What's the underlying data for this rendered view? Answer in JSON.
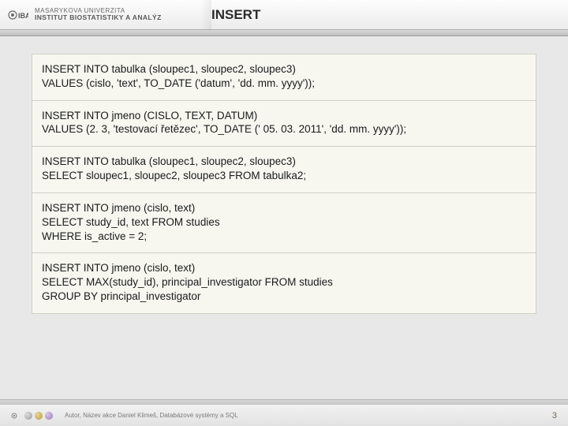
{
  "header": {
    "logo_line1": "MASARYKOVA UNIVERZITA",
    "logo_line2": "INSTITUT BIOSTATISTIKY A ANALÝZ",
    "logo_abbr": "IBA"
  },
  "slide": {
    "title": "INSERT"
  },
  "blocks": [
    {
      "line1": "INSERT INTO tabulka (sloupec1, sloupec2, sloupec3)",
      "line2": "VALUES (cislo, 'text', TO_DATE ('datum', 'dd. mm. yyyy'));"
    },
    {
      "line1": "INSERT INTO jmeno (CISLO, TEXT, DATUM)",
      "line2": "VALUES (2. 3, 'testovací řetězec', TO_DATE (' 05. 03. 2011', 'dd. mm. yyyy'));"
    },
    {
      "line1": "INSERT INTO tabulka (sloupec1, sloupec2, sloupec3)",
      "line2": "SELECT sloupec1, sloupec2, sloupec3 FROM tabulka2;"
    },
    {
      "line1": "INSERT INTO jmeno (cislo, text)",
      "line2": "SELECT study_id, text FROM studies",
      "line3": "WHERE is_active = 2;"
    },
    {
      "line1": "INSERT INTO jmeno (cislo, text)",
      "line2": "SELECT MAX(study_id), principal_investigator FROM studies",
      "line3": "GROUP BY principal_investigator"
    }
  ],
  "footer": {
    "text": "Autor, Název akce   Daniel Klimeš, Databázové systémy a SQL",
    "page": "3"
  }
}
